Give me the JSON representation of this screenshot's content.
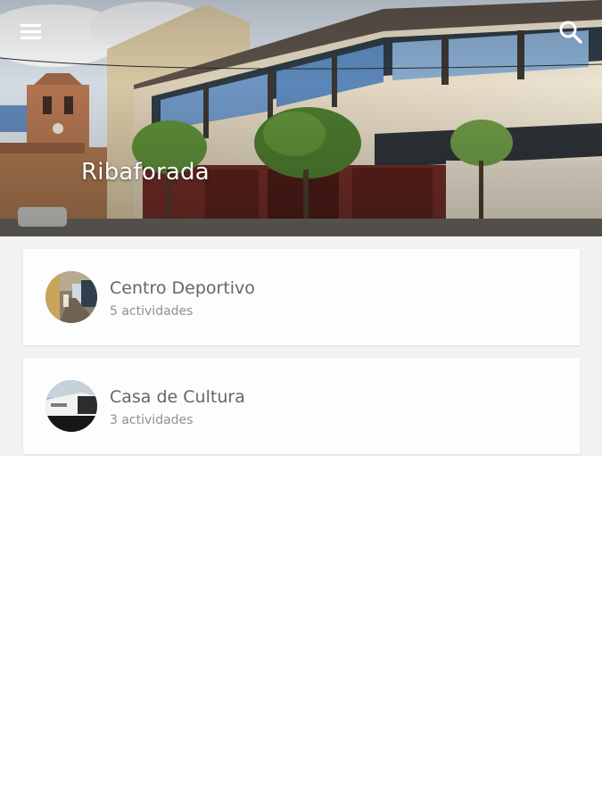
{
  "header": {
    "title": "Ribaforada",
    "menu_icon": "hamburger-menu-icon",
    "search_icon": "search-icon"
  },
  "places": [
    {
      "name": "Centro Deportivo",
      "activities": "5 actividades",
      "image": "sports-center-photo"
    },
    {
      "name": "Casa de Cultura",
      "activities": "3 actividades",
      "image": "culture-house-photo"
    }
  ],
  "colors": {
    "card_title": "#5f6770",
    "card_subtitle": "#8b9096",
    "list_background": "#f1f2f3",
    "header_text": "#ffffff"
  }
}
